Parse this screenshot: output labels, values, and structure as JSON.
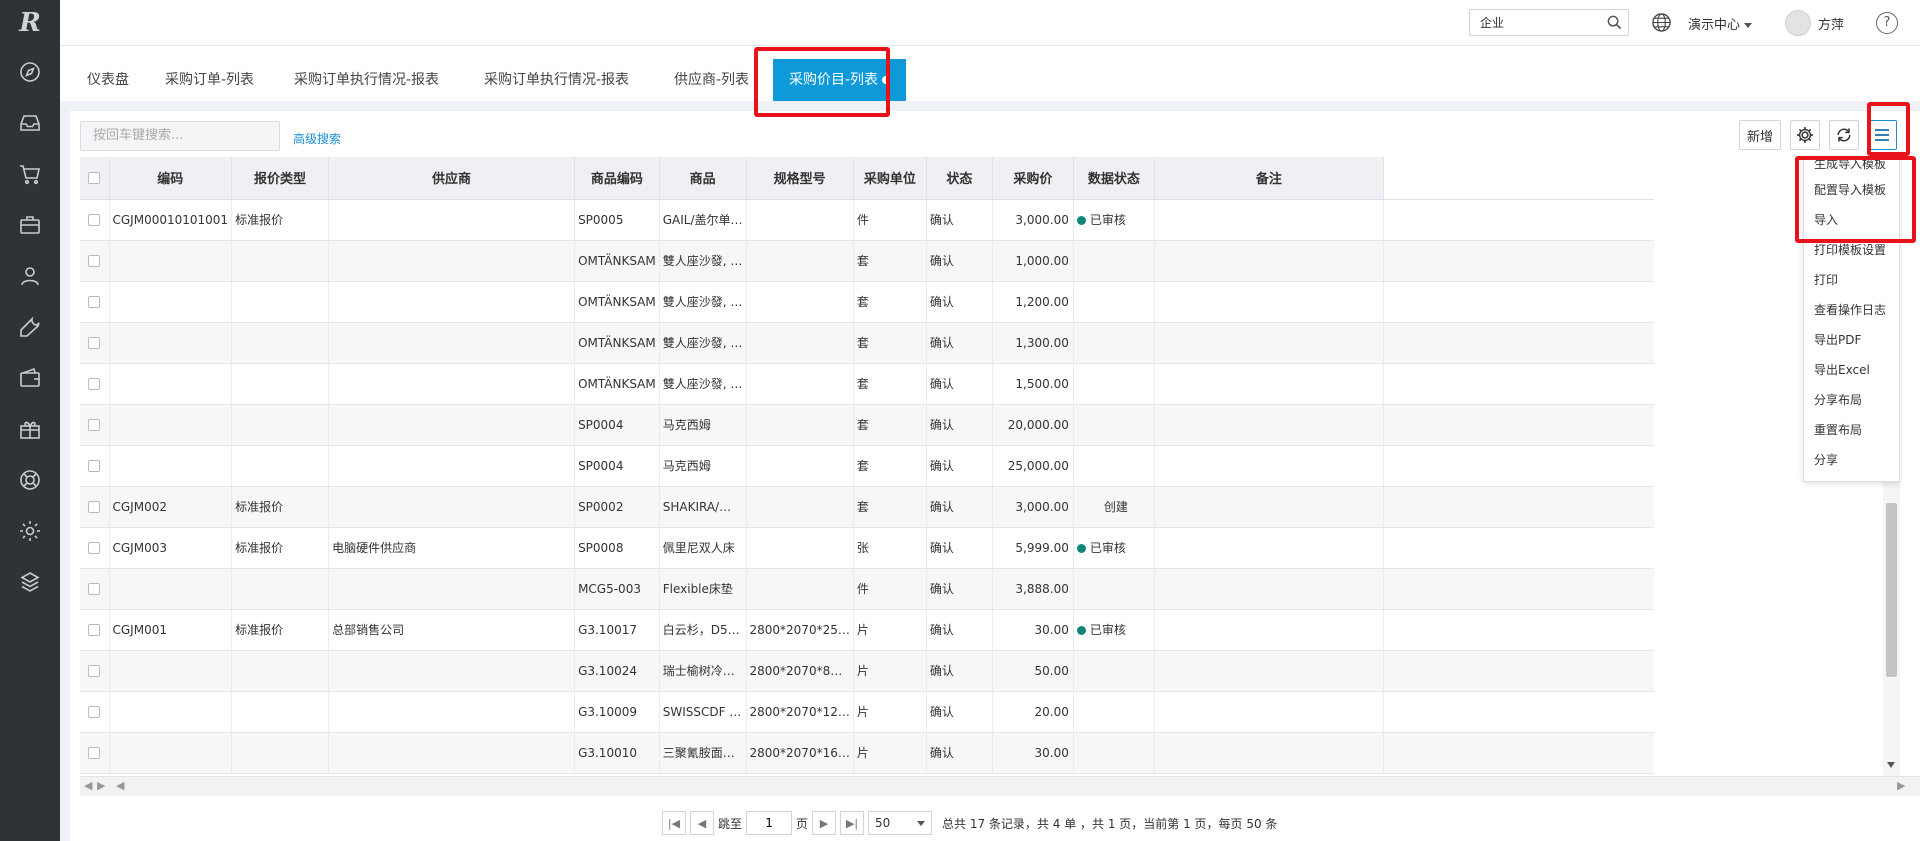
{
  "app": {
    "logo_text": "R"
  },
  "nav_icons": [
    "compass-icon",
    "inbox-icon",
    "cart-icon",
    "briefcase-icon",
    "user-icon",
    "wrench-icon",
    "wallet-icon",
    "gift-icon",
    "lifebuoy-icon",
    "settings-icon",
    "modules-icon"
  ],
  "topbar": {
    "search_value": "企业",
    "center_label": "演示中心",
    "username": "方萍",
    "help_glyph": "?"
  },
  "tabs": [
    {
      "label": "仪表盘"
    },
    {
      "label": "采购订单-列表"
    },
    {
      "label": "采购订单执行情况-报表"
    },
    {
      "label": "采购订单执行情况-报表"
    },
    {
      "label": "供应商-列表"
    },
    {
      "label": "采购价目-列表",
      "active": true
    }
  ],
  "toolbar": {
    "search_placeholder": "按回车键搜索...",
    "advanced_search": "高级搜索",
    "new_label": "新增"
  },
  "table": {
    "columns": [
      "编码",
      "报价类型",
      "供应商",
      "商品编码",
      "商品",
      "规格型号",
      "采购单位",
      "状态",
      "采购价",
      "数据状态",
      "备注"
    ],
    "rows": [
      [
        "CGJM00010101001",
        "标准报价",
        "",
        "SP0005",
        "GAIL/盖尔单…",
        "",
        "件",
        "确认",
        "3,000.00",
        "已审核",
        ""
      ],
      [
        "",
        "",
        "",
        "OMTÄNKSAM",
        "雙人座沙發, …",
        "",
        "套",
        "确认",
        "1,000.00",
        "",
        ""
      ],
      [
        "",
        "",
        "",
        "OMTÄNKSAM",
        "雙人座沙發, …",
        "",
        "套",
        "确认",
        "1,200.00",
        "",
        ""
      ],
      [
        "",
        "",
        "",
        "OMTÄNKSAM",
        "雙人座沙發, …",
        "",
        "套",
        "确认",
        "1,300.00",
        "",
        ""
      ],
      [
        "",
        "",
        "",
        "OMTÄNKSAM",
        "雙人座沙發, …",
        "",
        "套",
        "确认",
        "1,500.00",
        "",
        ""
      ],
      [
        "",
        "",
        "",
        "SP0004",
        "马克西姆",
        "",
        "套",
        "确认",
        "20,000.00",
        "",
        ""
      ],
      [
        "",
        "",
        "",
        "SP0004",
        "马克西姆",
        "",
        "套",
        "确认",
        "25,000.00",
        "",
        ""
      ],
      [
        "CGJM002",
        "标准报价",
        "",
        "SP0002",
        "SHAKIRA/…",
        "",
        "套",
        "确认",
        "3,000.00",
        "创建",
        ""
      ],
      [
        "CGJM003",
        "标准报价",
        "电脑硬件供应商",
        "SP0008",
        "佩里尼双人床",
        "",
        "张",
        "确认",
        "5,999.00",
        "已审核",
        ""
      ],
      [
        "",
        "",
        "",
        "MCG5-003",
        "Flexible床垫",
        "",
        "件",
        "确认",
        "3,888.00",
        "",
        ""
      ],
      [
        "CGJM001",
        "标准报价",
        "总部销售公司",
        "G3.10017",
        "白云杉，D5…",
        "2800*2070*25…",
        "片",
        "确认",
        "30.00",
        "已审核",
        ""
      ],
      [
        "",
        "",
        "",
        "G3.10024",
        "瑞士榆树冷…",
        "2800*2070*8…",
        "片",
        "确认",
        "50.00",
        "",
        ""
      ],
      [
        "",
        "",
        "",
        "G3.10009",
        "SWISSCDF …",
        "2800*2070*12…",
        "片",
        "确认",
        "20.00",
        "",
        ""
      ],
      [
        "",
        "",
        "",
        "G3.10010",
        "三聚氰胺面…",
        "2800*2070*16…",
        "片",
        "确认",
        "30.00",
        "",
        ""
      ]
    ]
  },
  "pager": {
    "jump_label": "跳至",
    "page_value": "1",
    "page_unit": "页",
    "page_size": "50",
    "summary": "总共 17 条记录，共 4 单 ，共 1 页，当前第 1 页，每页 50 条"
  },
  "dropdown_menu": [
    "生成导入模板",
    "配置导入模板",
    "导入",
    "打印模板设置",
    "打印",
    "查看操作日志",
    "导出PDF",
    "导出Excel",
    "分享布局",
    "重置布局",
    "分享"
  ],
  "colors": {
    "nav_bg": "#2f3337",
    "active_tab": "#0e9ad8",
    "approved_dot": "#12857a",
    "annotation": "#e8121b"
  }
}
